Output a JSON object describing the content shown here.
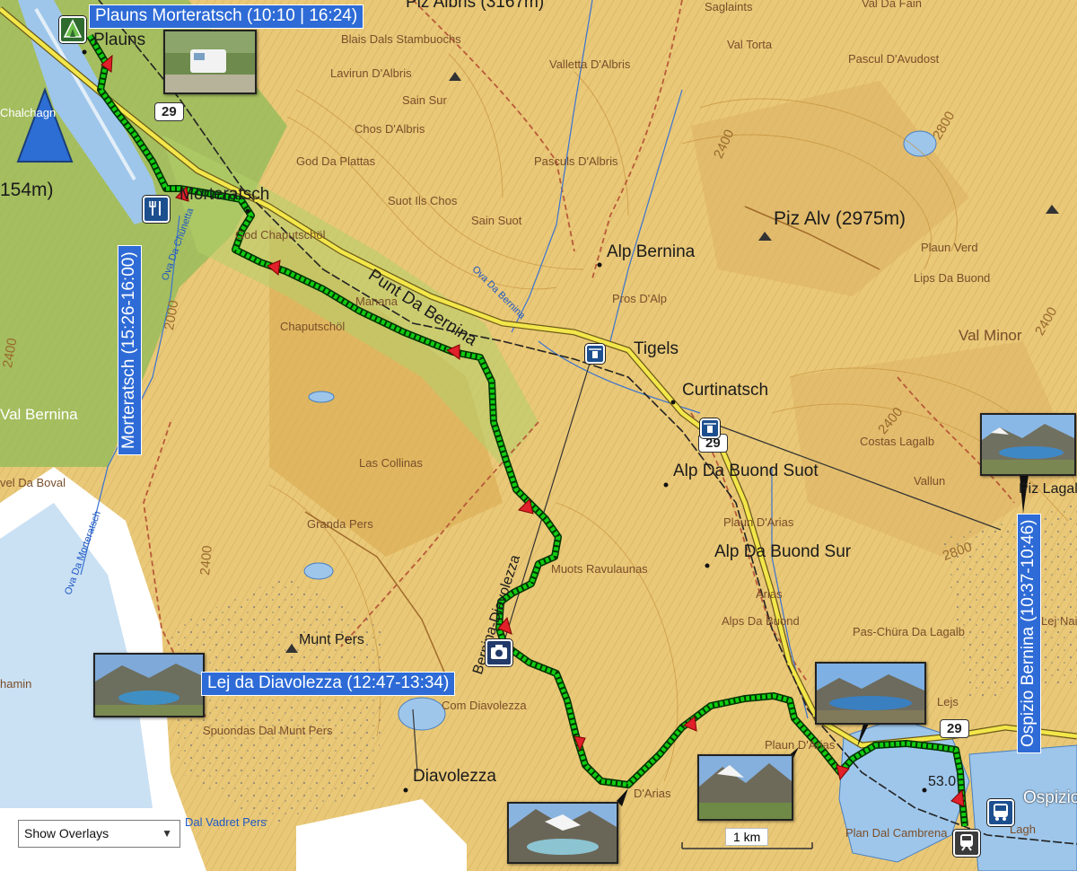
{
  "colors": {
    "terrain": "#e9c877",
    "valley": "#8dbb57",
    "lake": "#9ec6ea",
    "glacier": "#ffffff",
    "track": "#11cc11",
    "track_outline": "#003300",
    "callout": "#2e6bd6",
    "marker": "#e0202a"
  },
  "icons": {
    "campsite": "triangle-tent-icon",
    "restaurant": "fork-knife-icon",
    "camera": "camera-icon",
    "bus": "bus-icon",
    "train": "train-icon",
    "north_arrow": "north-arrow-icon",
    "cablecar": "cable-car-icon"
  },
  "callouts": {
    "start": "Plauns Morteratsch (10:10 | 16:24)",
    "morteratsch": "Morteratsch (15:26-16:00)",
    "lej": "Lej da Diavolezza (12:47-13:34)",
    "ospizio": "Ospizio Bernina (10:37-10:46)"
  },
  "places": {
    "piz_albris": "Piz Albris (3167m)",
    "plauns": "Plauns",
    "saglaints": "Saglaints",
    "val_da_fain": "Val Da Fain",
    "blais": "Blais Dals Stambuochs",
    "val_torta": "Val Torta",
    "lavirun": "Lavirun D'Albris",
    "valletta": "Valletta D'Albris",
    "pascul_avudost": "Pascul D'Avudost",
    "sain_sur": "Sain Sur",
    "chos": "Chos D'Albris",
    "god_da_plattas": "God Da Plattas",
    "pasculs": "Pasculs D'Albris",
    "morteratsch": "Morteratsch",
    "suot_ils_chos": "Suot Ils Chos",
    "sain_suot": "Sain Suot",
    "god_chaputschol": "God Chaputschöl",
    "piz_alv": "Piz Alv (2975m)",
    "alp_bernina": "Alp Bernina",
    "plaun_verd": "Plaun Verd",
    "lips": "Lips Da Buond",
    "punt_da_bernina": "Punt Da Bernina",
    "ova_da_bernina": "Ova Da Bernina",
    "pros": "Pros D'Alp",
    "manana": "Manana",
    "chaputschol": "Chaputschöl",
    "tigels": "Tigels",
    "val_minor": "Val Minor",
    "curtinatsch": "Curtinatsch",
    "alp_da_buond_suot": "Alp Da Buond Suot",
    "costas_lagalb": "Costas Lagalb",
    "vallun": "Vallun",
    "piz_lagalb": "Piz Lagalb",
    "las_collinas": "Las Collinas",
    "alp_da_buond_sur": "Alp Da Buond Sur",
    "plaun_darias": "Plaun D'Arias",
    "munt_pers": "Munt Pers",
    "muots_ravulaunas": "Muots Ravulaunas",
    "arias": "Arias",
    "alps_da_buond": "Alps Da Buond",
    "pas_chura": "Pas-Chüra Da Lagalb",
    "diavolezza_track": "Bernina-Diavolezza",
    "plaun_da_lej": "Plaun D'Arias",
    "com_diavolezza": "Com Diavolezza",
    "spuondas": "Spuondas Dal Munt Pers",
    "diavolezza": "Diavolezza",
    "d_arias": "D'Arias",
    "vadret_pers": "Dal Vadret Pers",
    "plan_dal_cambrena": "Plan Dal Cambrena",
    "lej_la_gera": "Lej Nair",
    "lagh": "Lagh",
    "ospizio": "Ospizio",
    "val_bernina": "Val Bernina",
    "vel_da_boval": "vel Da Boval",
    "chalchagn": "Chalchagn",
    "ova_morteratsch": "Ova Da Morteratsch",
    "ova_da_chunetta": "Ova Da Chünetta",
    "elev_left": "154m)",
    "spot_53": "53.0",
    "chamin": "hamin",
    "lejs": "Lejs",
    "gra_pers": "Granda Pers",
    "c_2800": "2800",
    "c_2400a": "2400",
    "c_2400b": "2400",
    "c_2400c": "2400",
    "c_2800b": "2800",
    "c_2400d": "2400",
    "c_2000": "2000",
    "c_2400e": "2400"
  },
  "roads": {
    "shield_a": "29",
    "shield_b": "29",
    "shield_c": "29"
  },
  "controls": {
    "overlays": "Show Overlays"
  },
  "scale": {
    "label": "1 km"
  }
}
